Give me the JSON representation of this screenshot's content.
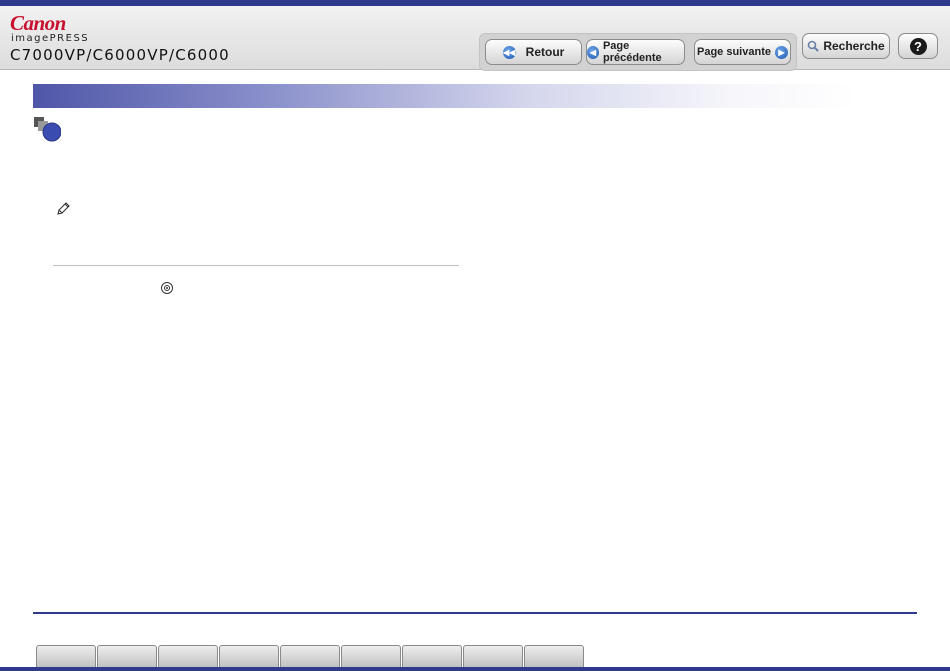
{
  "header": {
    "brand": "Canon",
    "product": "imagePRESS",
    "model": "C7000VP/C6000VP/C6000",
    "colors": {
      "brand_red": "#c8102e",
      "accent_blue": "#303a8c"
    }
  },
  "nav": {
    "back_label": "Retour",
    "back_icon": "rewind-icon",
    "prev_label": "Page précédente",
    "prev_icon": "arrow-left-icon",
    "next_label": "Page suivante",
    "next_icon": "arrow-right-icon",
    "search_label": "Recherche",
    "search_icon": "search-icon",
    "help_icon": "help-icon",
    "help_glyph": "?"
  },
  "footer": {
    "tabs": [
      "",
      "",
      "",
      "",
      "",
      "",
      "",
      "",
      "",
      ""
    ]
  }
}
